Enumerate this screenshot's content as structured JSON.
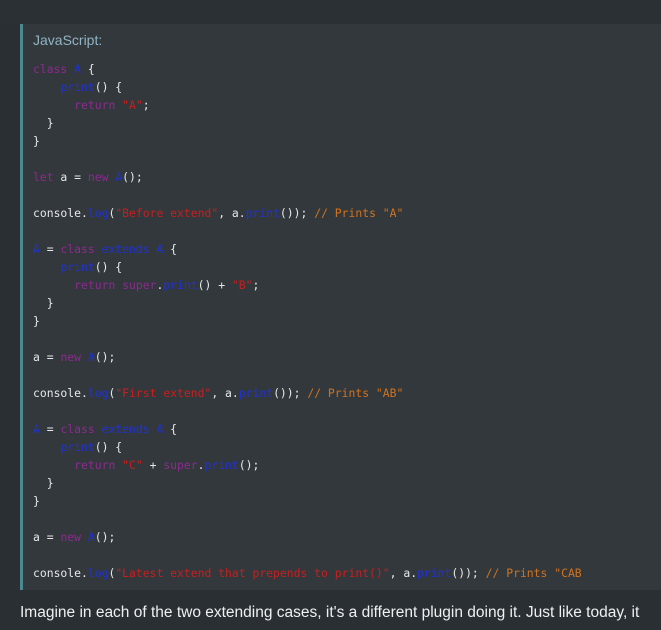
{
  "code_block": {
    "language_label": "JavaScript:",
    "lines": [
      [
        {
          "c": "kw",
          "t": "class"
        },
        {
          "c": "pl",
          "t": " "
        },
        {
          "c": "fn",
          "t": "A"
        },
        {
          "c": "pl",
          "t": " {"
        }
      ],
      [
        {
          "c": "pl",
          "t": "    "
        },
        {
          "c": "fn",
          "t": "print"
        },
        {
          "c": "pl",
          "t": "() {"
        }
      ],
      [
        {
          "c": "pl",
          "t": "      "
        },
        {
          "c": "kw",
          "t": "return"
        },
        {
          "c": "pl",
          "t": " "
        },
        {
          "c": "str",
          "t": "\"A\""
        },
        {
          "c": "pl",
          "t": ";"
        }
      ],
      [
        {
          "c": "pl",
          "t": "  }"
        }
      ],
      [
        {
          "c": "pl",
          "t": "}"
        }
      ],
      [],
      [
        {
          "c": "kw",
          "t": "let"
        },
        {
          "c": "pl",
          "t": " a = "
        },
        {
          "c": "kw",
          "t": "new"
        },
        {
          "c": "pl",
          "t": " "
        },
        {
          "c": "fn",
          "t": "A"
        },
        {
          "c": "pl",
          "t": "();"
        }
      ],
      [],
      [
        {
          "c": "pl",
          "t": "console."
        },
        {
          "c": "fn",
          "t": "log"
        },
        {
          "c": "pl",
          "t": "("
        },
        {
          "c": "str",
          "t": "\"Before extend\""
        },
        {
          "c": "pl",
          "t": ", a."
        },
        {
          "c": "fn",
          "t": "print"
        },
        {
          "c": "pl",
          "t": "()); "
        },
        {
          "c": "cm",
          "t": "// Prints \"A\""
        }
      ],
      [],
      [
        {
          "c": "fn",
          "t": "A"
        },
        {
          "c": "pl",
          "t": " = "
        },
        {
          "c": "kw",
          "t": "class"
        },
        {
          "c": "pl",
          "t": " "
        },
        {
          "c": "fn",
          "t": "extends"
        },
        {
          "c": "pl",
          "t": " "
        },
        {
          "c": "fn",
          "t": "A"
        },
        {
          "c": "pl",
          "t": " {"
        }
      ],
      [
        {
          "c": "pl",
          "t": "    "
        },
        {
          "c": "fn",
          "t": "print"
        },
        {
          "c": "pl",
          "t": "() {"
        }
      ],
      [
        {
          "c": "pl",
          "t": "      "
        },
        {
          "c": "kw",
          "t": "return"
        },
        {
          "c": "pl",
          "t": " "
        },
        {
          "c": "kw",
          "t": "super"
        },
        {
          "c": "pl",
          "t": "."
        },
        {
          "c": "fn",
          "t": "print"
        },
        {
          "c": "pl",
          "t": "() + "
        },
        {
          "c": "str",
          "t": "\"B\""
        },
        {
          "c": "pl",
          "t": ";"
        }
      ],
      [
        {
          "c": "pl",
          "t": "  }"
        }
      ],
      [
        {
          "c": "pl",
          "t": "}"
        }
      ],
      [],
      [
        {
          "c": "pl",
          "t": "a = "
        },
        {
          "c": "kw",
          "t": "new"
        },
        {
          "c": "pl",
          "t": " "
        },
        {
          "c": "fn",
          "t": "A"
        },
        {
          "c": "pl",
          "t": "();"
        }
      ],
      [],
      [
        {
          "c": "pl",
          "t": "console."
        },
        {
          "c": "fn",
          "t": "log"
        },
        {
          "c": "pl",
          "t": "("
        },
        {
          "c": "str",
          "t": "\"First extend\""
        },
        {
          "c": "pl",
          "t": ", a."
        },
        {
          "c": "fn",
          "t": "print"
        },
        {
          "c": "pl",
          "t": "()); "
        },
        {
          "c": "cm",
          "t": "// Prints \"AB\""
        }
      ],
      [],
      [
        {
          "c": "fn",
          "t": "A"
        },
        {
          "c": "pl",
          "t": " = "
        },
        {
          "c": "kw",
          "t": "class"
        },
        {
          "c": "pl",
          "t": " "
        },
        {
          "c": "fn",
          "t": "extends"
        },
        {
          "c": "pl",
          "t": " "
        },
        {
          "c": "fn",
          "t": "A"
        },
        {
          "c": "pl",
          "t": " {"
        }
      ],
      [
        {
          "c": "pl",
          "t": "    "
        },
        {
          "c": "fn",
          "t": "print"
        },
        {
          "c": "pl",
          "t": "() {"
        }
      ],
      [
        {
          "c": "pl",
          "t": "      "
        },
        {
          "c": "kw",
          "t": "return"
        },
        {
          "c": "pl",
          "t": " "
        },
        {
          "c": "str",
          "t": "\"C\""
        },
        {
          "c": "pl",
          "t": " + "
        },
        {
          "c": "kw",
          "t": "super"
        },
        {
          "c": "pl",
          "t": "."
        },
        {
          "c": "fn",
          "t": "print"
        },
        {
          "c": "pl",
          "t": "();"
        }
      ],
      [
        {
          "c": "pl",
          "t": "  }"
        }
      ],
      [
        {
          "c": "pl",
          "t": "}"
        }
      ],
      [],
      [
        {
          "c": "pl",
          "t": "a = "
        },
        {
          "c": "kw",
          "t": "new"
        },
        {
          "c": "pl",
          "t": " "
        },
        {
          "c": "fn",
          "t": "A"
        },
        {
          "c": "pl",
          "t": "();"
        }
      ],
      [],
      [
        {
          "c": "pl",
          "t": "console."
        },
        {
          "c": "fn",
          "t": "log"
        },
        {
          "c": "pl",
          "t": "("
        },
        {
          "c": "str",
          "t": "\"Latest extend that prepends to print()\""
        },
        {
          "c": "pl",
          "t": ", a."
        },
        {
          "c": "fn",
          "t": "print"
        },
        {
          "c": "pl",
          "t": "()); "
        },
        {
          "c": "cm",
          "t": "// Prints \"CAB"
        }
      ]
    ]
  },
  "prose": {
    "text": "Imagine in each of the two extending cases, it's a different plugin doing it. Just like today, it"
  },
  "colors": {
    "page_background": "#2a2f33",
    "code_background": "#33383c",
    "accent_border": "#4c8a8f",
    "keyword": "#8c2a8f",
    "function": "#1f32d6",
    "string": "#c81f1f",
    "comment": "#d0731f",
    "plain": "#e6e8ea"
  }
}
